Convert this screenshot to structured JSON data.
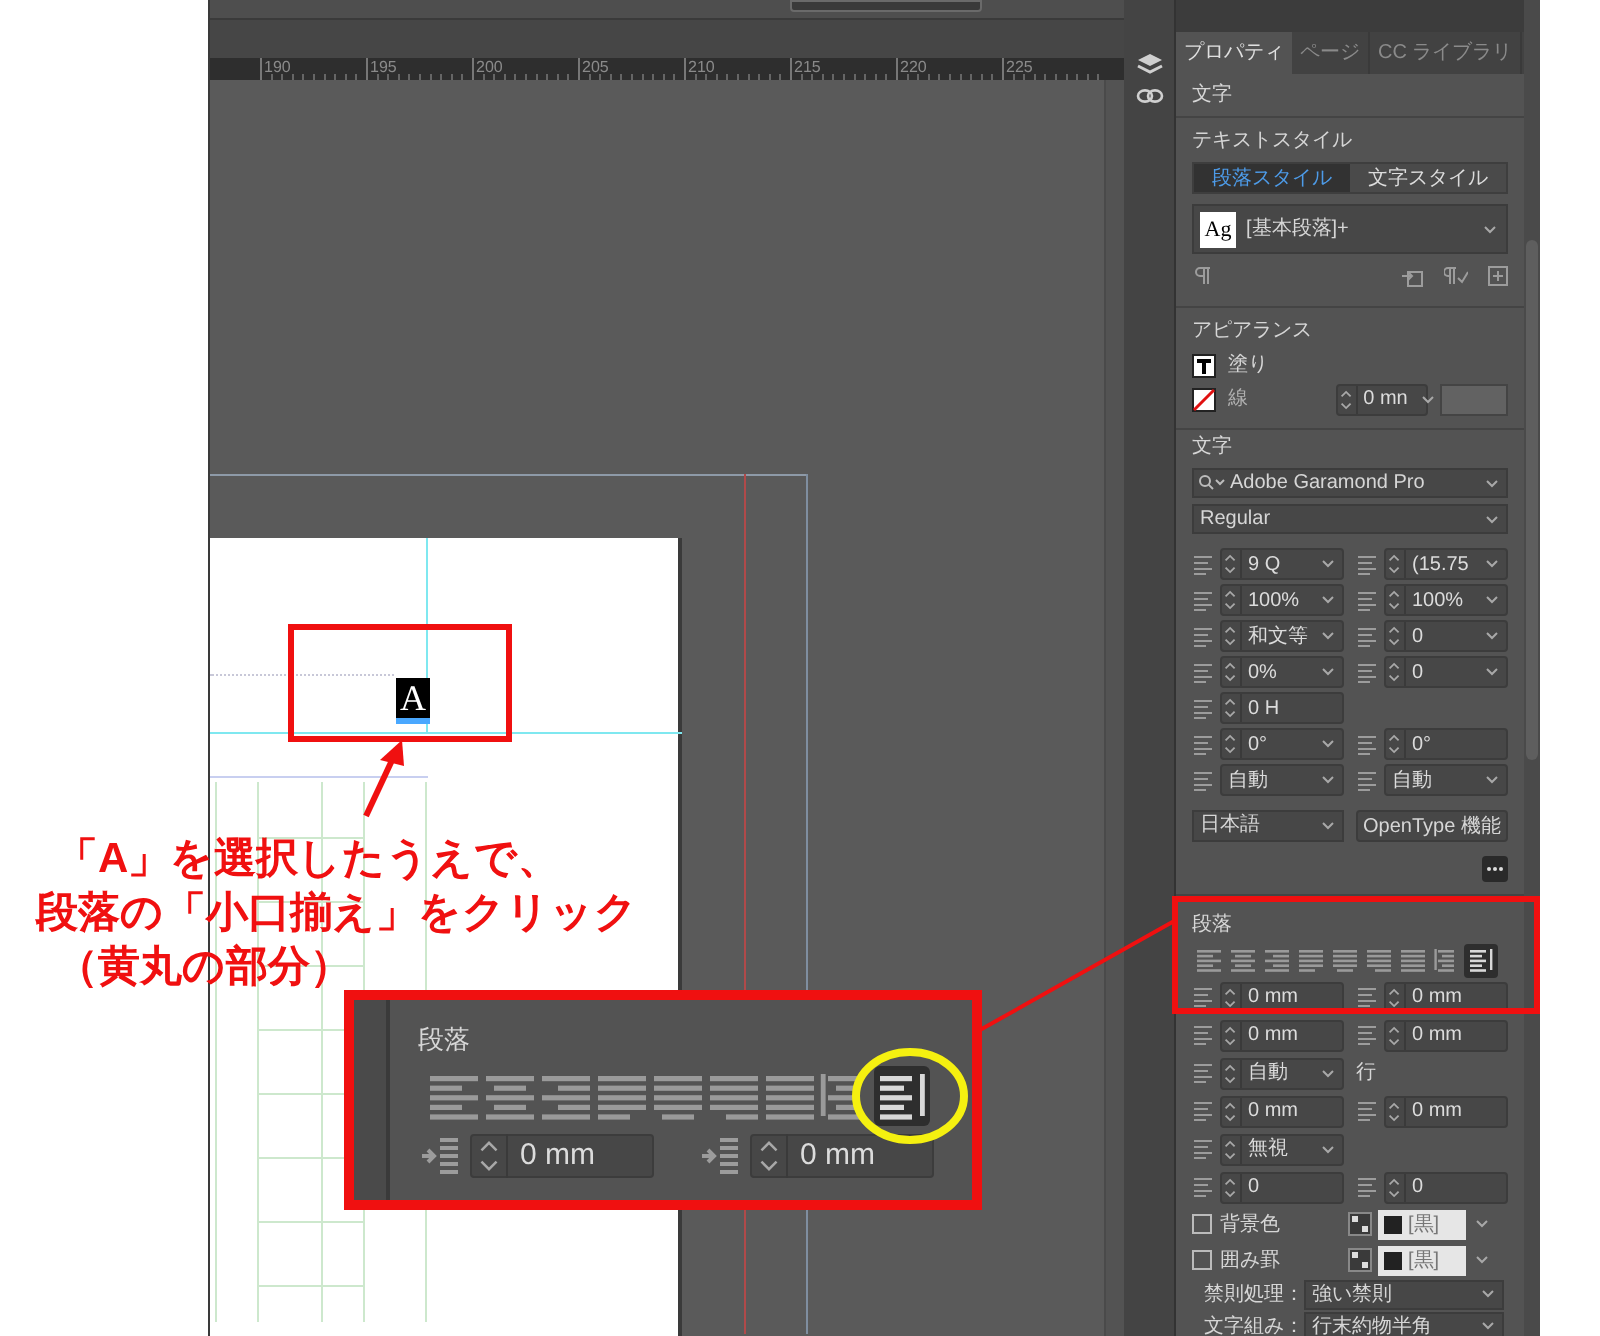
{
  "canvas": {
    "ruler_labels": [
      "190",
      "195",
      "200",
      "205",
      "210",
      "215",
      "220",
      "225"
    ],
    "selected_text": "A"
  },
  "annotation": {
    "lines": [
      "「A」を選択したうえで、",
      "段落の「小口揃え」をクリック",
      "（黄丸の部分）"
    ],
    "callout": {
      "title": "段落",
      "alignment": [
        {
          "kind": "left",
          "selected": false
        },
        {
          "kind": "center",
          "selected": false
        },
        {
          "kind": "right",
          "selected": false
        },
        {
          "kind": "justify_left",
          "selected": false
        },
        {
          "kind": "justify_center",
          "selected": false
        },
        {
          "kind": "justify_right",
          "selected": false
        },
        {
          "kind": "justify_all",
          "selected": false
        },
        {
          "kind": "toward_spine",
          "selected": false
        },
        {
          "kind": "away_from_spine",
          "selected": true
        }
      ],
      "fields": [
        {
          "kind": "spin",
          "value": "0 mm"
        },
        {
          "kind": "spin",
          "value": "0 mm"
        }
      ]
    }
  },
  "properties_panel": {
    "tabs": [
      {
        "label": "プロパティ",
        "selected": true
      },
      {
        "label": "ページ",
        "selected": false
      },
      {
        "label": "CC ライブラリ",
        "selected": false
      }
    ],
    "selection_type": "文字",
    "text_style": {
      "title": "テキストスタイル",
      "modes": [
        {
          "label": "段落スタイル",
          "selected": true
        },
        {
          "label": "文字スタイル",
          "selected": false
        }
      ],
      "preview": "Ag",
      "style": "[基本段落]+"
    },
    "appearance": {
      "title": "アピアランス",
      "fill": "塗り",
      "stroke": "線",
      "stroke_weight": {
        "kind": "spin_drop",
        "value": "0 mn"
      }
    },
    "character": {
      "title": "文字",
      "font": "Adobe Garamond Pro",
      "font_style": "Regular",
      "rows": [
        [
          {
            "kind": "spin_drop",
            "value": "9 Q"
          },
          {
            "kind": "spin_drop",
            "value": "(15.75"
          }
        ],
        [
          {
            "kind": "spin_drop",
            "value": "100%"
          },
          {
            "kind": "spin_drop",
            "value": "100%"
          }
        ],
        [
          {
            "kind": "spin_drop",
            "value": "和文等"
          },
          {
            "kind": "spin_drop",
            "value": "0"
          }
        ],
        [
          {
            "kind": "spin_drop",
            "value": "0%"
          },
          {
            "kind": "spin_drop",
            "value": "0"
          }
        ],
        [
          {
            "kind": "spin",
            "value": "0 H"
          }
        ],
        [
          {
            "kind": "spin_drop",
            "value": "0°"
          },
          {
            "kind": "spin",
            "value": "0°"
          }
        ],
        [
          {
            "kind": "dropdown",
            "value": "自動"
          },
          {
            "kind": "dropdown",
            "value": "自動"
          }
        ]
      ],
      "language": "日本語",
      "opentype_button": "OpenType 機能"
    },
    "paragraph": {
      "title": "段落",
      "alignment": [
        {
          "kind": "left",
          "selected": false
        },
        {
          "kind": "center",
          "selected": false
        },
        {
          "kind": "right",
          "selected": false
        },
        {
          "kind": "justify_left",
          "selected": false
        },
        {
          "kind": "justify_center",
          "selected": false
        },
        {
          "kind": "justify_right",
          "selected": false
        },
        {
          "kind": "justify_all",
          "selected": false
        },
        {
          "kind": "toward_spine",
          "selected": false
        },
        {
          "kind": "away_from_spine",
          "selected": true
        }
      ],
      "rows": [
        [
          {
            "kind": "spin",
            "value": "0 mm"
          },
          {
            "kind": "spin",
            "value": "0 mm"
          }
        ],
        [
          {
            "kind": "spin",
            "value": "0 mm"
          },
          {
            "kind": "spin",
            "value": "0 mm"
          }
        ],
        [
          {
            "kind": "spin_drop",
            "value": "自動",
            "unit": "行"
          }
        ],
        [
          {
            "kind": "spin",
            "value": "0 mm"
          },
          {
            "kind": "spin",
            "value": "0 mm"
          }
        ],
        [
          {
            "kind": "spin_drop",
            "value": "無視"
          }
        ],
        [
          {
            "kind": "spin",
            "value": "0"
          },
          {
            "kind": "spin",
            "value": "0"
          }
        ]
      ],
      "options": [
        {
          "label": "背景色",
          "checked": false,
          "swatch": "[黒]"
        },
        {
          "label": "囲み罫",
          "checked": false,
          "swatch": "[黒]"
        }
      ],
      "settings": [
        {
          "label": "禁則処理：",
          "value": "強い禁則"
        },
        {
          "label": "文字組み：",
          "value": "行末約物半角"
        }
      ]
    }
  }
}
